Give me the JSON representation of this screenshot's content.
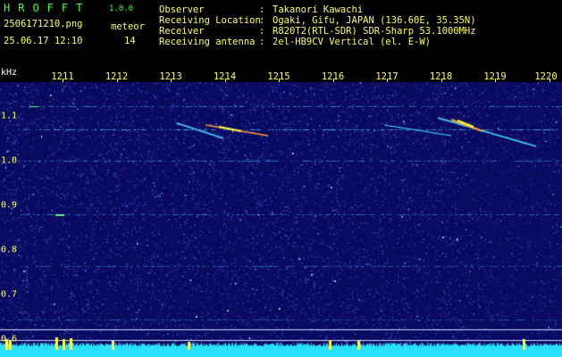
{
  "header": {
    "brand": "HROFFT",
    "version": "1.0.0",
    "filename": "2506171210.png",
    "datetime": "25.06.17 12:10",
    "meteor_label": "meteor",
    "meteor_count": "14",
    "info": [
      {
        "label": "Observer",
        "value": "Takanori Kawachi"
      },
      {
        "label": "Receiving Location",
        "value": "Ogaki, Gifu, JAPAN (136.60E, 35.35N)"
      },
      {
        "label": "Receiver",
        "value": "R820T2(RTL-SDR) SDR-Sharp 53.1000MHz"
      },
      {
        "label": "Receiving antenna",
        "value": "2el-HB9CV Vertical (el. E-W)"
      }
    ]
  },
  "axis": {
    "unit": "kHz",
    "x_ticks": [
      "1211",
      "1212",
      "1213",
      "1214",
      "1215",
      "1216",
      "1217",
      "1218",
      "1219",
      "1220"
    ],
    "y_ticks": [
      "1.1",
      "1.0",
      "0.9",
      "0.8",
      "0.7",
      "0.6"
    ]
  },
  "colors": {
    "background": "#0a0a60",
    "noise": "#2a3aa8",
    "signal": "#3ce0ff",
    "strong": "#ffff40",
    "text_green": "#3dff3d",
    "text_yellow": "#ffff55"
  }
}
